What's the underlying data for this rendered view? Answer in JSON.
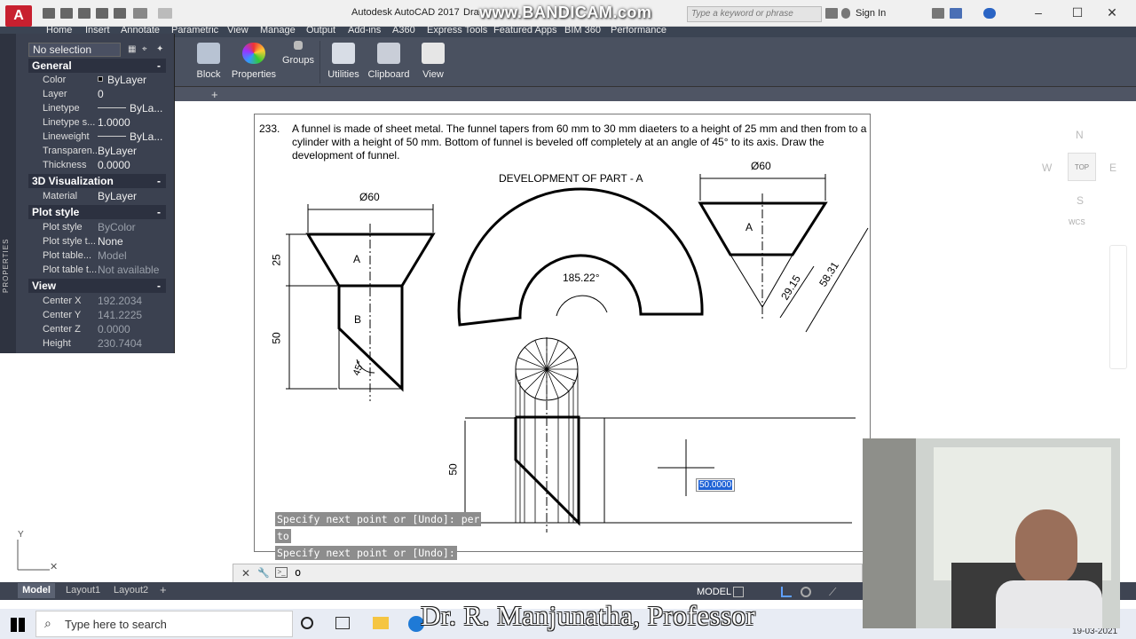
{
  "titlebar": {
    "app_title": "Autodesk AutoCAD 2017",
    "app_title_suffix": "Dra",
    "overlay_watermark": "www.BANDICAM.com",
    "search_placeholder": "Type a keyword or phrase",
    "signin_label": "Sign In"
  },
  "ribbon": {
    "tabs": [
      "Home",
      "Insert",
      "Annotate",
      "Parametric",
      "View",
      "Manage",
      "Output",
      "Add-ins",
      "A360",
      "Express Tools",
      "Featured Apps",
      "BIM 360",
      "Performance"
    ],
    "panels": [
      "Block",
      "Properties",
      "Groups",
      "Utilities",
      "Clipboard",
      "View"
    ]
  },
  "properties": {
    "selection": "No selection",
    "sidebar_label": "PROPERTIES",
    "sections": {
      "general": "General",
      "visualization": "3D Visualization",
      "plot_style": "Plot style",
      "view": "View"
    },
    "general": [
      {
        "label": "Color",
        "value": "ByLayer"
      },
      {
        "label": "Layer",
        "value": "0"
      },
      {
        "label": "Linetype",
        "value": "ByLa..."
      },
      {
        "label": "Linetype s...",
        "value": "1.0000"
      },
      {
        "label": "Lineweight",
        "value": "ByLa..."
      },
      {
        "label": "Transparen...",
        "value": "ByLayer"
      },
      {
        "label": "Thickness",
        "value": "0.0000"
      }
    ],
    "visualization": [
      {
        "label": "Material",
        "value": "ByLayer"
      }
    ],
    "plot_style": [
      {
        "label": "Plot style",
        "value": "ByColor"
      },
      {
        "label": "Plot style t...",
        "value": "None"
      },
      {
        "label": "Plot table...",
        "value": "Model"
      },
      {
        "label": "Plot table t...",
        "value": "Not available"
      }
    ],
    "view": [
      {
        "label": "Center X",
        "value": "192.2034"
      },
      {
        "label": "Center Y",
        "value": "141.2225"
      },
      {
        "label": "Center Z",
        "value": "0.0000"
      },
      {
        "label": "Height",
        "value": "230.7404"
      }
    ]
  },
  "drawing": {
    "problem_number": "233.",
    "problem_text": "A funnel is made of sheet metal.   The funnel tapers from 60 mm to 30 mm diaeters to a height of 25 mm and then from to a cylinder with a height of 50 mm.   Bottom of funnel is beveled off completely at an angle of 45° to its axis.   Draw the development of funnel.",
    "dev_title": "DEVELOPMENT OF PART - A",
    "dia_left": "Ø60",
    "dia_right": "Ø60",
    "dim_25": "25",
    "dim_50": "50",
    "dim_50_lower": "50",
    "label_a_left": "A",
    "label_b": "B",
    "label_a_right": "A",
    "angle_45": "45°",
    "angle_dev": "185.22°",
    "dim_2915": "29.15",
    "dim_5831": "58.31"
  },
  "viewcube": {
    "n": "N",
    "s": "S",
    "e": "E",
    "w": "W",
    "top": "TOP",
    "wcs": "WCS"
  },
  "command": {
    "history": [
      "Specify next point or [Undo]: per",
      "to",
      "Specify next point or [Undo]:"
    ],
    "input": "o",
    "dynamic_input": "50.0000"
  },
  "layouts": {
    "tabs": [
      "Model",
      "Layout1",
      "Layout2"
    ],
    "status_model": "MODEL"
  },
  "taskbar": {
    "search_placeholder": "Type here to search",
    "date": "19-03-2021"
  },
  "video_watermark": "Dr. R. Manjunatha, Professor"
}
